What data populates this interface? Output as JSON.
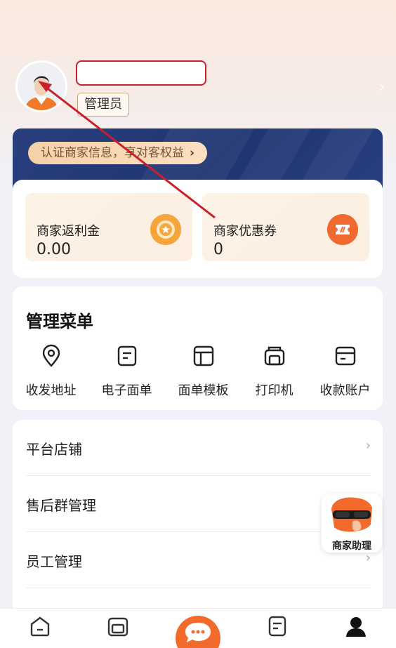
{
  "profile": {
    "role_badge": "管理员",
    "chevron": "›"
  },
  "banner": {
    "verify_text": "认证商家信息，享对客权益",
    "verify_arrow": "›"
  },
  "benefits": [
    {
      "title": "商家返利金",
      "value": "0.00",
      "icon": "coin-icon"
    },
    {
      "title": "商家优惠券",
      "value": "0",
      "icon": "coupon-icon"
    }
  ],
  "menu": {
    "title": "管理菜单",
    "items": [
      {
        "label": "收发地址",
        "icon": "location-pin-icon"
      },
      {
        "label": "电子面单",
        "icon": "document-icon"
      },
      {
        "label": "面单模板",
        "icon": "template-icon"
      },
      {
        "label": "打印机",
        "icon": "printer-icon"
      },
      {
        "label": "收款账户",
        "icon": "card-icon"
      }
    ]
  },
  "list": [
    {
      "label": "平台店铺",
      "chevron": "›"
    },
    {
      "label": "售后群管理",
      "chevron": "›"
    },
    {
      "label": "员工管理",
      "chevron": "›"
    }
  ],
  "assistant": {
    "label": "商家助理"
  },
  "colors": {
    "accent": "#f36a2d",
    "banner": "#1f3571",
    "annotation": "#c8202a"
  }
}
